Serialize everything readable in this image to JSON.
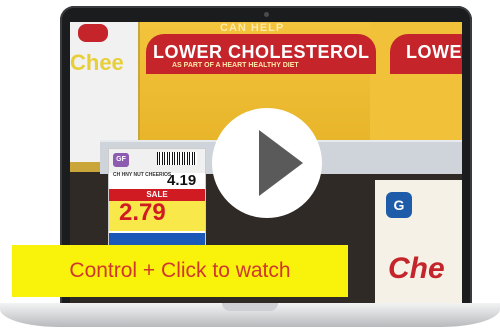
{
  "video": {
    "box_headline_left": "LOWER CHOLESTEROL",
    "box_headline_right": "LOWE",
    "box_kicker": "CAN HELP",
    "box_subline": "AS PART OF A HEART HEALTHY DIET",
    "left_box_text": "Chee",
    "price_tag": {
      "badge": "GF",
      "item_label": "CH HNY NUT CHEERIOS",
      "regular_price": "4.19",
      "sale_label": "SALE",
      "sale_price": "2.79"
    },
    "gm_logo": "G",
    "right_box_text": "Che",
    "play_icon": "play-icon"
  },
  "caption": {
    "text": "Control + Click to watch"
  },
  "colors": {
    "caption_bg": "#f9f20a",
    "caption_text": "#d0372f",
    "play_circle": "#ffffff",
    "play_triangle": "#5a5a5a"
  }
}
